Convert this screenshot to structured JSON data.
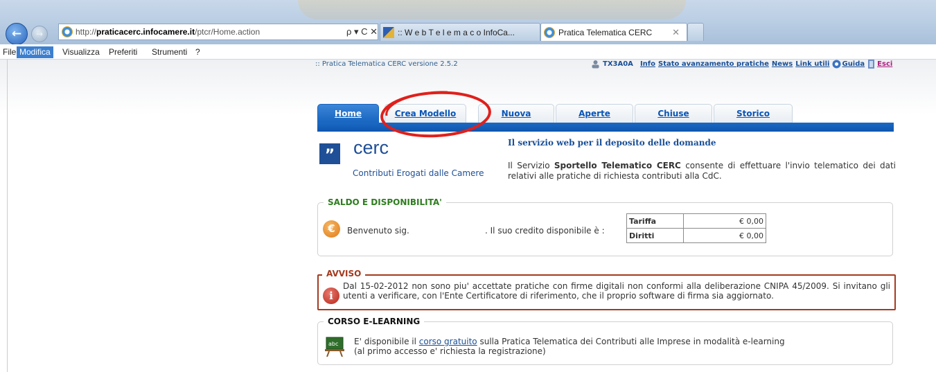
{
  "browser": {
    "url_prefix": "http://",
    "url_domain": "praticacerc.infocamere.it",
    "url_path": "/ptcr/Home.action",
    "address_controls": "ρ ▾ C ✕",
    "tabs": [
      {
        "label": ":: W e b T e l e m a c o InfoCa..."
      },
      {
        "label": "Pratica Telematica CERC",
        "close": "✕"
      }
    ],
    "menu": [
      "File",
      "Modifica",
      "Visualizza",
      "Preferiti",
      "Strumenti",
      "?"
    ]
  },
  "header": {
    "version": ":: Pratica Telematica CERC versione 2.5.2",
    "user_id": "TX3A0A",
    "links": [
      "Info",
      "Stato avanzamento pratiche",
      "News",
      "Link utili",
      "Guida",
      "Esci"
    ]
  },
  "tabs": [
    "Home",
    "Crea Modello",
    "Nuova",
    "Aperte",
    "Chiuse",
    "Storico"
  ],
  "logo": {
    "mark": "”",
    "word": "cerc",
    "subtitle": "Contributi Erogati dalle Camere"
  },
  "intro": {
    "title": "Il servizio web per il deposito delle domande",
    "text_before": "Il Servizio ",
    "text_bold": "Sportello Telematico CERC",
    "text_after": " consente di effettuare l'invio telematico dei dati relativi alle pratiche di richiesta contributi alla CdC."
  },
  "saldo": {
    "legend": "SALDO E DISPONIBILITA'",
    "icon_symbol": "€",
    "welcome": "Benvenuto sig.",
    "credit_text": ". Il suo credito disponibile è :",
    "rows": [
      {
        "label": "Tariffa",
        "value": "€ 0,00"
      },
      {
        "label": "Diritti",
        "value": "€ 0,00"
      }
    ]
  },
  "avviso": {
    "legend": "AVVISO",
    "icon_symbol": "i",
    "text": "Dal 15-02-2012 non sono piu' accettate pratiche con firme digitali non conformi alla deliberazione CNIPA 45/2009. Si invitano gli utenti a verificare, con l'Ente Certificatore di riferimento, che il proprio software di firma sia aggiornato."
  },
  "corso": {
    "legend": "CORSO E-LEARNING",
    "text_before": "E' disponibile il ",
    "link": "corso gratuito",
    "text_after": " sulla Pratica Telematica dei Contributi alle Imprese in modalità e-learning",
    "text_line2": "(al primo accesso e' richiesta la registrazione)",
    "icon_text": "abc"
  },
  "colors": {
    "accent_blue": "#1765c0",
    "link_blue": "#1a4f96",
    "saldo_green": "#2e7d1e",
    "avviso_red": "#a33a1f",
    "annotation_red": "#e0201c"
  }
}
